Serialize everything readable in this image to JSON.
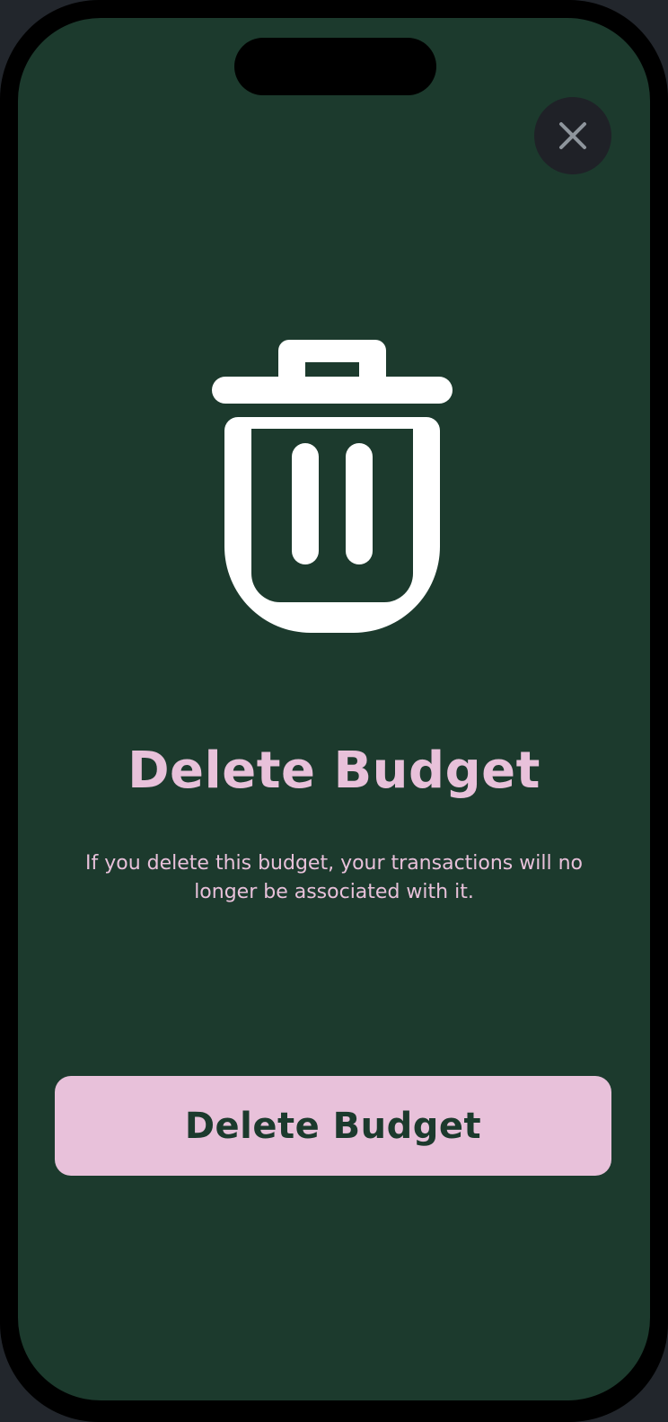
{
  "dialog": {
    "title": "Delete Budget",
    "description": "If you delete this budget, your transactions will no longer be associated with it.",
    "confirm_label": "Delete Budget",
    "close_icon": "close-icon",
    "hero_icon": "trash-icon"
  },
  "colors": {
    "background": "#1c3a2d",
    "accent": "#e8c1da",
    "button_text": "#1c3a2d",
    "icon": "#ffffff",
    "close_button_bg": "#1f2127",
    "close_icon": "#8e959c"
  }
}
